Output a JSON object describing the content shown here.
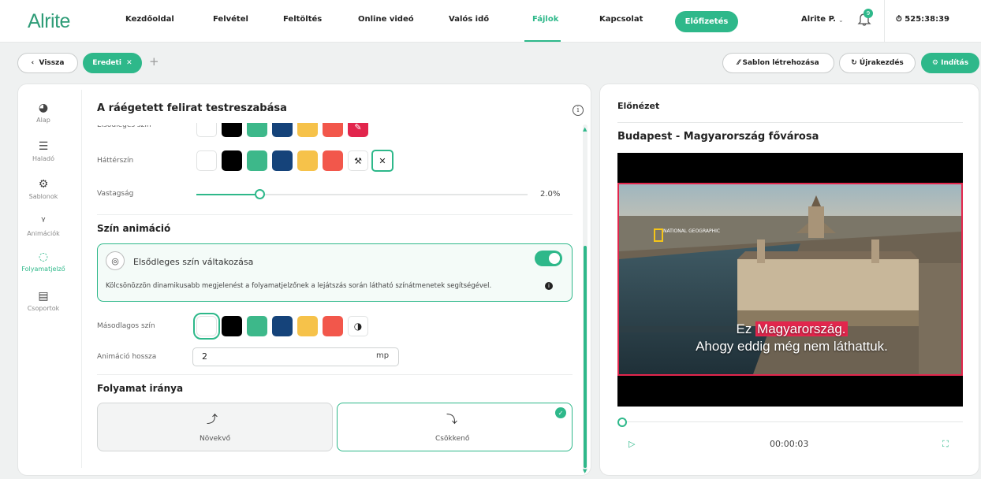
{
  "app": {
    "logo": "Alrite"
  },
  "nav": {
    "items": [
      {
        "label": "Kezdőoldal"
      },
      {
        "label": "Felvétel"
      },
      {
        "label": "Feltöltés"
      },
      {
        "label": "Online videó"
      },
      {
        "label": "Valós idő"
      },
      {
        "label": "Fájlok",
        "active": true
      },
      {
        "label": "Kapcsolat"
      }
    ],
    "subscribe": "Előfizetés",
    "user": "Alrite P.",
    "notifications": "9",
    "timer": "525:38:39"
  },
  "toolbar": {
    "back": "Vissza",
    "tab": "Eredeti",
    "add": "+",
    "template": "Sablon létrehozása",
    "restart": "Újrakezdés",
    "start": "Indítás"
  },
  "sidebar": {
    "items": [
      {
        "label": "Alap",
        "icon": "palette-icon"
      },
      {
        "label": "Haladó",
        "icon": "sliders-icon"
      },
      {
        "label": "Sablonok",
        "icon": "gear-icon"
      },
      {
        "label": "Animációk",
        "icon": "animation-icon"
      },
      {
        "label": "Folyamatjelző",
        "icon": "progress-icon",
        "active": true
      },
      {
        "label": "Csoportok",
        "icon": "groups-icon"
      }
    ]
  },
  "editor": {
    "title": "A ráégetett felirat testreszabása",
    "primary_color_label": "Elsődleges szín",
    "bg_color_label": "Háttérszín",
    "thickness_label": "Vastagság",
    "thickness_value": "2.0%",
    "thickness_fraction": 0.19,
    "color_anim_title": "Szín animáció",
    "anim_toggle_label": "Elsődleges szín váltakozása",
    "anim_desc": "Kölcsönözzön dinamikusabb megjelenést a folyamatjelzőnek a lejátszás során látható színátmenetek segítségével.",
    "secondary_color_label": "Másodlagos szín",
    "anim_length_label": "Animáció hossza",
    "anim_length_value": "2",
    "anim_length_unit": "mp",
    "direction_title": "Folyamat iránya",
    "dir_increasing": "Növekvő",
    "dir_decreasing": "Csökkenő",
    "selected_direction": "Csökkenő"
  },
  "colors": {
    "swatches": [
      "#ffffff",
      "#000000",
      "#3db88a",
      "#15437a",
      "#f6c24a",
      "#f2574b"
    ],
    "accent": "#2eb88a",
    "highlight": "#e2264d"
  },
  "preview": {
    "title": "Előnézet",
    "video_title": "Budapest - Magyarország fővárosa",
    "logo_text": "NATIONAL GEOGRAPHIC",
    "subtitle_pre": "Ez ",
    "subtitle_hl": "Magyarország.",
    "subtitle_line2": "Ahogy eddig még nem láthattuk.",
    "time": "00:00:03"
  }
}
